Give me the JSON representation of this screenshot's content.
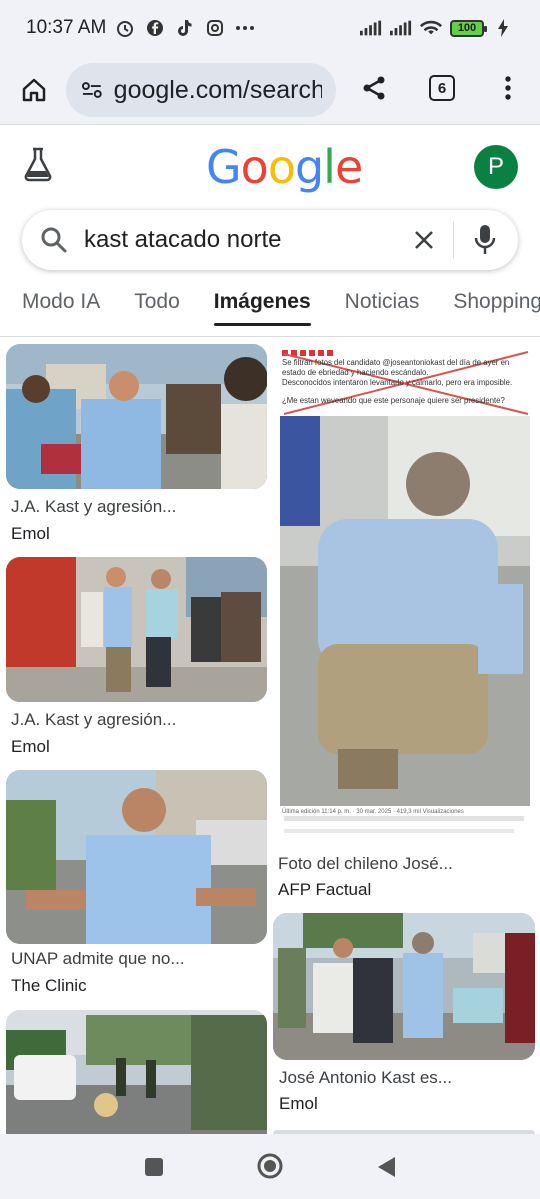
{
  "status": {
    "time": "10:37 AM",
    "battery": "100"
  },
  "browser": {
    "url": "google.com/search",
    "tab_count": "6"
  },
  "logo": [
    "G",
    "o",
    "o",
    "g",
    "l",
    "e"
  ],
  "logo_colors": [
    "#4285F4",
    "#EA4335",
    "#FBBC05",
    "#4285F4",
    "#34A853",
    "#EA4335"
  ],
  "avatar_letter": "P",
  "search": {
    "query": "kast atacado norte"
  },
  "tabs": [
    {
      "label": "Modo IA"
    },
    {
      "label": "Todo"
    },
    {
      "label": "Imágenes"
    },
    {
      "label": "Noticias"
    },
    {
      "label": "Shopping"
    }
  ],
  "results": [
    {
      "title": "J.A. Kast y agresión...",
      "source": "Emol"
    },
    {
      "title": "J.A. Kast y agresión...",
      "source": "Emol"
    },
    {
      "title": "UNAP admite que no...",
      "source": "The Clinic"
    },
    {
      "title": "",
      "source": ""
    },
    {
      "title": "Foto del chileno José...",
      "source": "AFP Factual"
    },
    {
      "title": "José Antonio Kast es...",
      "source": "Emol"
    }
  ],
  "tweet": {
    "line1": "Se filtran fotos del candidato @joseantoniokast del día de ayer en",
    "line2": "estado de ebriedad y haciendo escándalo.",
    "line3": "Desconocidos intentaron levantarlo y calmarlo, pero era imposible.",
    "line4": "¿Me estan weveando que este personaje quiere ser presidente?",
    "footer": "Última edición 11:14 p. m. · 30 mar. 2025 · 419,3 mil Visualizaciones"
  }
}
